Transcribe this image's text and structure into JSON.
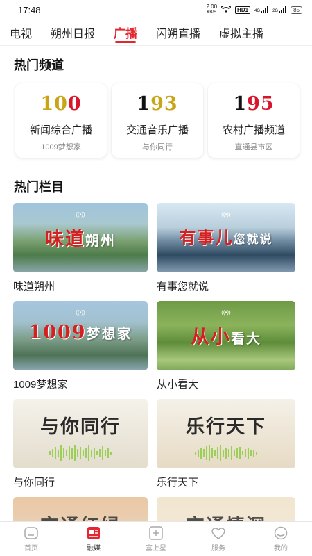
{
  "status_bar": {
    "time": "17:48",
    "net_speed": "2.00",
    "net_unit": "KB/S",
    "hd": "HD1",
    "sig1": "4G",
    "sig2": "2G",
    "battery": "85"
  },
  "tabs": [
    {
      "label": "电视",
      "active": false
    },
    {
      "label": "朔州日报",
      "active": false
    },
    {
      "label": "广播",
      "active": true
    },
    {
      "label": "闪朔直播",
      "active": false
    },
    {
      "label": "虚拟主播",
      "active": false
    }
  ],
  "hot_channels": {
    "title": "热门频道",
    "items": [
      {
        "freq_a": "10",
        "freq_b": "0",
        "name": "新闻综合广播",
        "sub": "1009梦想家"
      },
      {
        "freq_a": "1",
        "freq_b": "93",
        "name": "交通音乐广播",
        "sub": "与你同行"
      },
      {
        "freq_a": "1",
        "freq_b": "95",
        "name": "农村广播频道",
        "sub": "直通县市区"
      }
    ]
  },
  "hot_programs": {
    "title": "热门栏目",
    "items": [
      {
        "art_red": "味道",
        "art_white": "朔州",
        "label": "味道朔州"
      },
      {
        "art_red": "有事儿",
        "art_white": "您就说",
        "label": "有事您就说"
      },
      {
        "art_red": "1009",
        "art_white": "梦想家",
        "label": "1009梦想家"
      },
      {
        "art_red": "从小",
        "art_white": "看大",
        "label": "从小看大"
      },
      {
        "art_red": "",
        "art_white": "与你同行",
        "label": "与你同行"
      },
      {
        "art_red": "",
        "art_white": "乐行天下",
        "label": "乐行天下"
      },
      {
        "art_red": "",
        "art_white": "交通红绿",
        "label": ""
      },
      {
        "art_red": "",
        "art_white": "交通情深",
        "label": ""
      }
    ]
  },
  "bottom_nav": [
    {
      "label": "首页",
      "icon": "home-icon",
      "active": false
    },
    {
      "label": "融媒",
      "icon": "media-icon",
      "active": true
    },
    {
      "label": "塞上星",
      "icon": "plus-box-icon",
      "active": false
    },
    {
      "label": "服务",
      "icon": "heart-icon",
      "active": false
    },
    {
      "label": "我的",
      "icon": "user-icon",
      "active": false
    }
  ],
  "colors": {
    "accent": "#e3262f",
    "freq_gold": "#c9a516",
    "freq_red": "#d8152a"
  }
}
